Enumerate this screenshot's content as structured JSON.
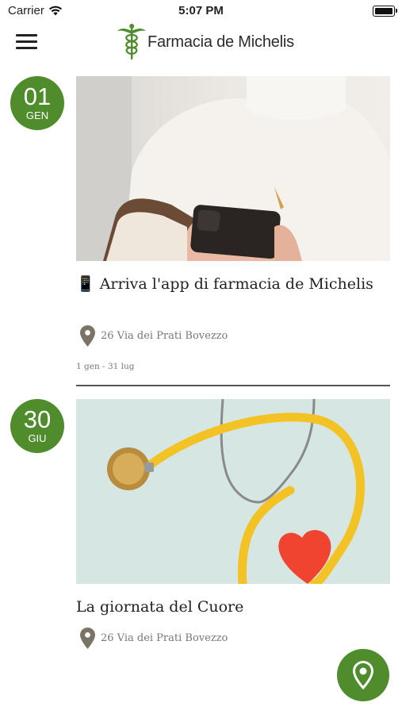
{
  "status_bar": {
    "carrier": "Carrier",
    "time": "5:07 PM"
  },
  "header": {
    "title": "Farmacia de Michelis",
    "menu_icon": "hamburger-menu-icon",
    "logo_icon": "caduceus-icon"
  },
  "colors": {
    "accent": "#4f8c2c",
    "text": "#222222",
    "muted": "#777777"
  },
  "events": [
    {
      "day": "01",
      "month": "GEN",
      "title": "📱 Arriva l'app di farmacia de Michelis",
      "location": "26 Via dei Prati Bovezzo",
      "dates": "1 gen - 31 lug"
    },
    {
      "day": "30",
      "month": "GIU",
      "title": "La giornata del Cuore",
      "location": "26 Via dei Prati Bovezzo"
    }
  ],
  "fab": {
    "icon": "map-pin-icon"
  }
}
